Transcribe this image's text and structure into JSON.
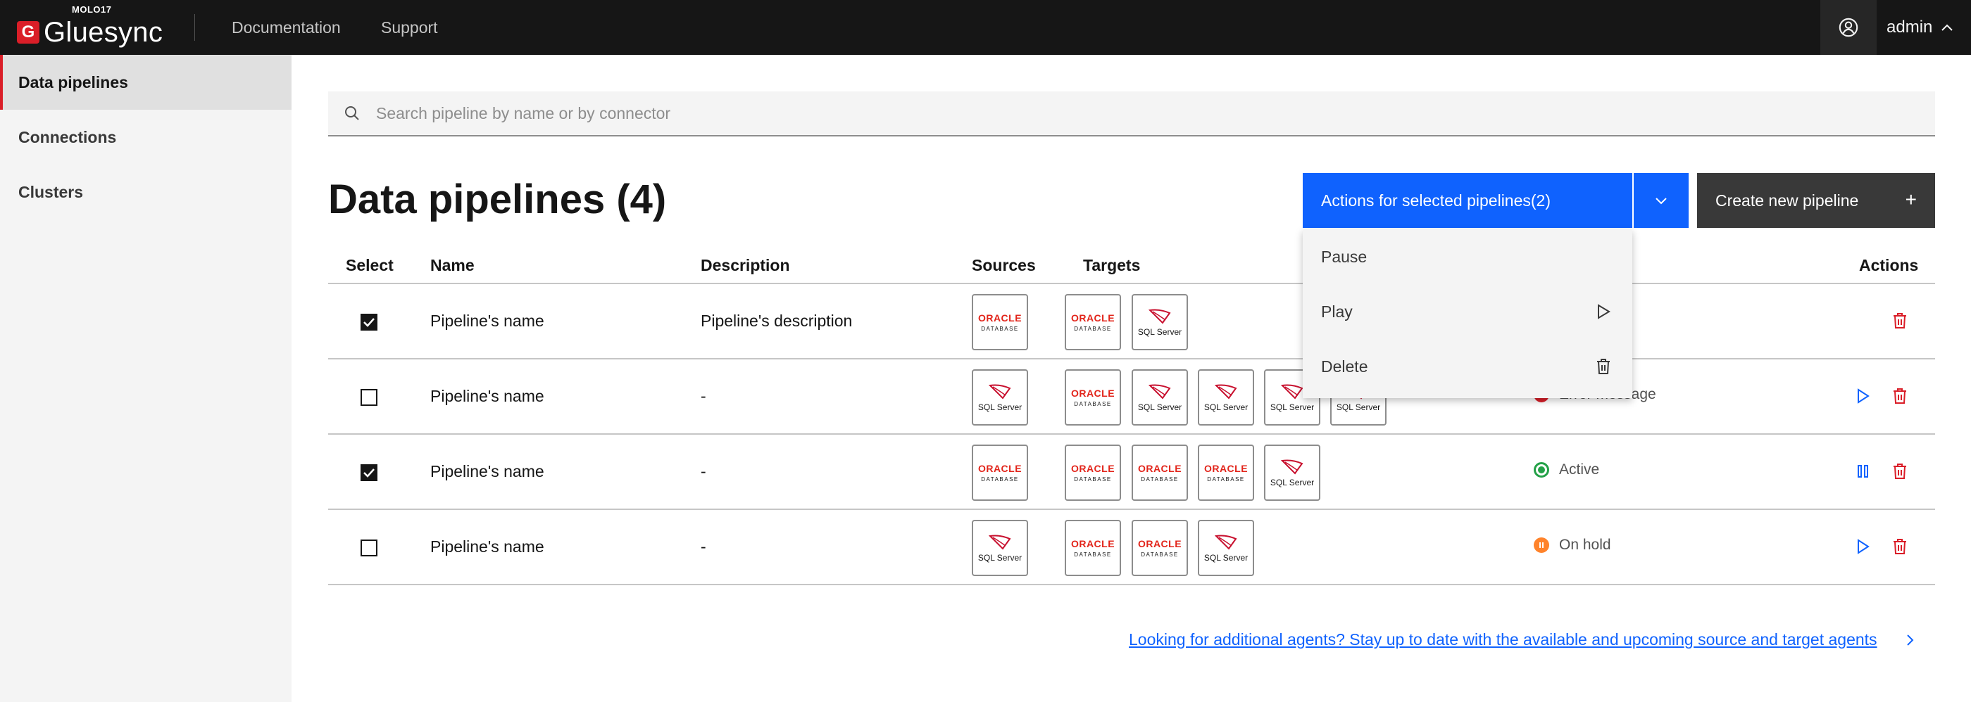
{
  "header": {
    "brand_small": "MOLO17",
    "brand_name": "Gluesync",
    "brand_logo_letter": "G",
    "nav": [
      "Documentation",
      "Support"
    ],
    "user_label": "admin"
  },
  "sidebar": {
    "items": [
      {
        "label": "Data pipelines",
        "active": true
      },
      {
        "label": "Connections",
        "active": false
      },
      {
        "label": "Clusters",
        "active": false
      }
    ]
  },
  "search": {
    "placeholder": "Search pipeline by name or by connector"
  },
  "main": {
    "title": "Data pipelines (4)",
    "actions_button": "Actions for selected pipelines(2)",
    "create_button": "Create new pipeline",
    "create_icon": "+"
  },
  "actions_menu": {
    "items": [
      {
        "label": "Pause",
        "icon": ""
      },
      {
        "label": "Play",
        "icon": "play-icon"
      },
      {
        "label": "Delete",
        "icon": "trash-icon"
      }
    ]
  },
  "table": {
    "columns": [
      "Select",
      "Name",
      "Description",
      "Sources",
      "Targets",
      "Actions"
    ],
    "connector_labels": {
      "oracle": "ORACLE",
      "oracle_sub": "DATABASE",
      "sql": "SQL Server"
    },
    "rows": [
      {
        "checked": true,
        "name": "Pipeline's name",
        "description": "Pipeline's description",
        "sources": [
          "oracle"
        ],
        "targets": [
          "oracle",
          "sql"
        ],
        "status": "",
        "status_color": ""
      },
      {
        "checked": false,
        "name": "Pipeline's name",
        "description": "-",
        "sources": [
          "sql"
        ],
        "targets": [
          "oracle",
          "sql",
          "sql",
          "sql",
          "sql"
        ],
        "status": "Error message",
        "status_color": "#da1e28"
      },
      {
        "checked": true,
        "name": "Pipeline's name",
        "description": "-",
        "sources": [
          "oracle"
        ],
        "targets": [
          "oracle",
          "oracle",
          "oracle",
          "sql"
        ],
        "status": "Active",
        "status_color": "#24a148"
      },
      {
        "checked": false,
        "name": "Pipeline's name",
        "description": "-",
        "sources": [
          "sql"
        ],
        "targets": [
          "oracle",
          "oracle",
          "sql"
        ],
        "status": "On hold",
        "status_color": "#ff832b"
      }
    ]
  },
  "footer": {
    "link": "Looking for additional agents? Stay up to date with the available and upcoming source and target agents"
  },
  "colors": {
    "brand_red": "#da1e28",
    "primary_blue": "#0f62fe",
    "topbar": "#161616",
    "delete_red": "#da1e28"
  }
}
